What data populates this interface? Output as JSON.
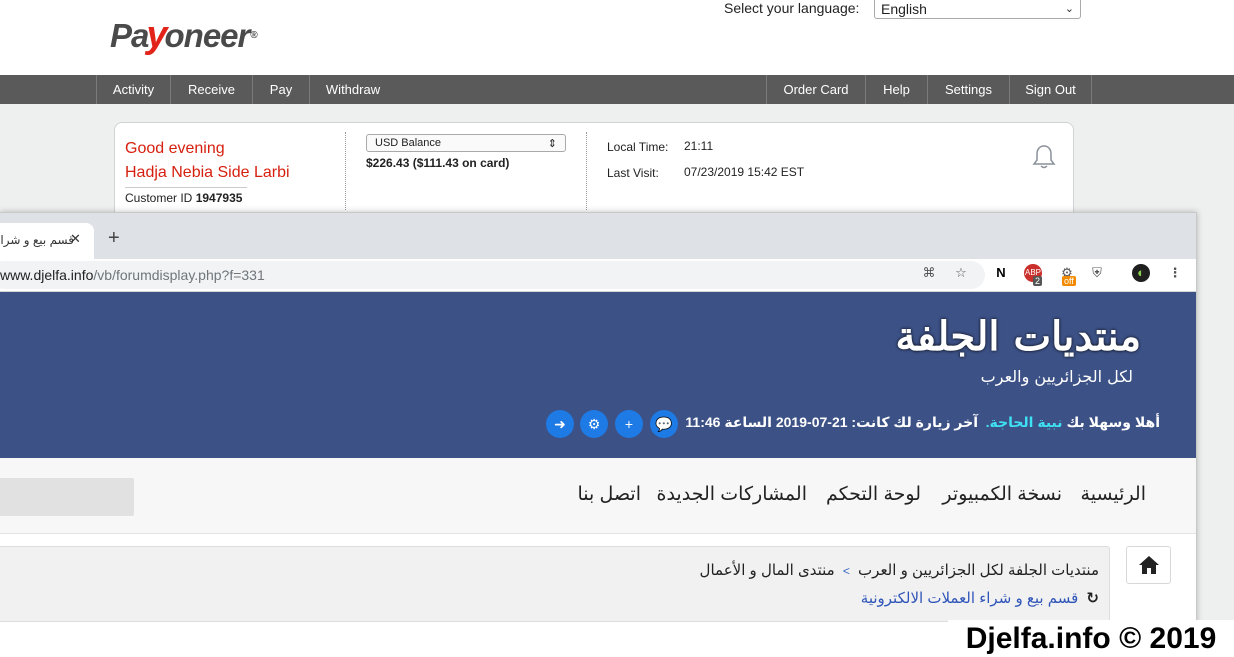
{
  "payoneer": {
    "logo_text": "Payoneer",
    "language_label": "Select your language:",
    "language_selected": "English",
    "nav": {
      "left": [
        "Activity",
        "Receive",
        "Pay",
        "Withdraw"
      ],
      "right": [
        "Order Card",
        "Help",
        "Settings",
        "Sign Out"
      ]
    },
    "greeting": "Good evening",
    "user_name": "Hadja Nebia Side Larbi",
    "customer_id_label": "Customer ID",
    "customer_id": "1947935",
    "balance_selected": "USD Balance",
    "balance_amount": "$226.43 ($111.43 on card)",
    "local_time_label": "Local Time:",
    "local_time": "21:11",
    "last_visit_label": "Last Visit:",
    "last_visit": "07/23/2019 15:42 EST"
  },
  "browser": {
    "tab_title": "قسم بيع و شراء",
    "url_host": "www.djelfa.info",
    "url_path": "/vb/forumdisplay.php?f=331",
    "extension_badges": {
      "abp_count": "2",
      "ext_off": "off"
    }
  },
  "forum": {
    "logo_main": "منتديات الجلفة",
    "logo_sub": "لكل الجزائريين والعرب",
    "welcome_prefix": "أهلا وسهلا بك",
    "welcome_user": "نبية الحاجة.",
    "last_visit_text": "آخر زيارة لك كانت: 21-07-2019 الساعة 11:46",
    "nav_links": [
      "الرئيسية",
      "نسخة الكمبيوتر",
      "لوحة التحكم",
      "المشاركات الجديدة",
      "اتصل بنا"
    ],
    "breadcrumb": {
      "root": "منتديات الجلفة لكل الجزائريين و العرب",
      "separator": ">",
      "section": "منتدى المال و الأعمال",
      "current": "قسم بيع و شراء العملات الالكترونية"
    },
    "colors": {
      "header_bg": "#3c5186",
      "accent_blue": "#1e7be6",
      "username_color": "#3ee0f2"
    }
  },
  "watermark": "Djelfa.info © 2019"
}
